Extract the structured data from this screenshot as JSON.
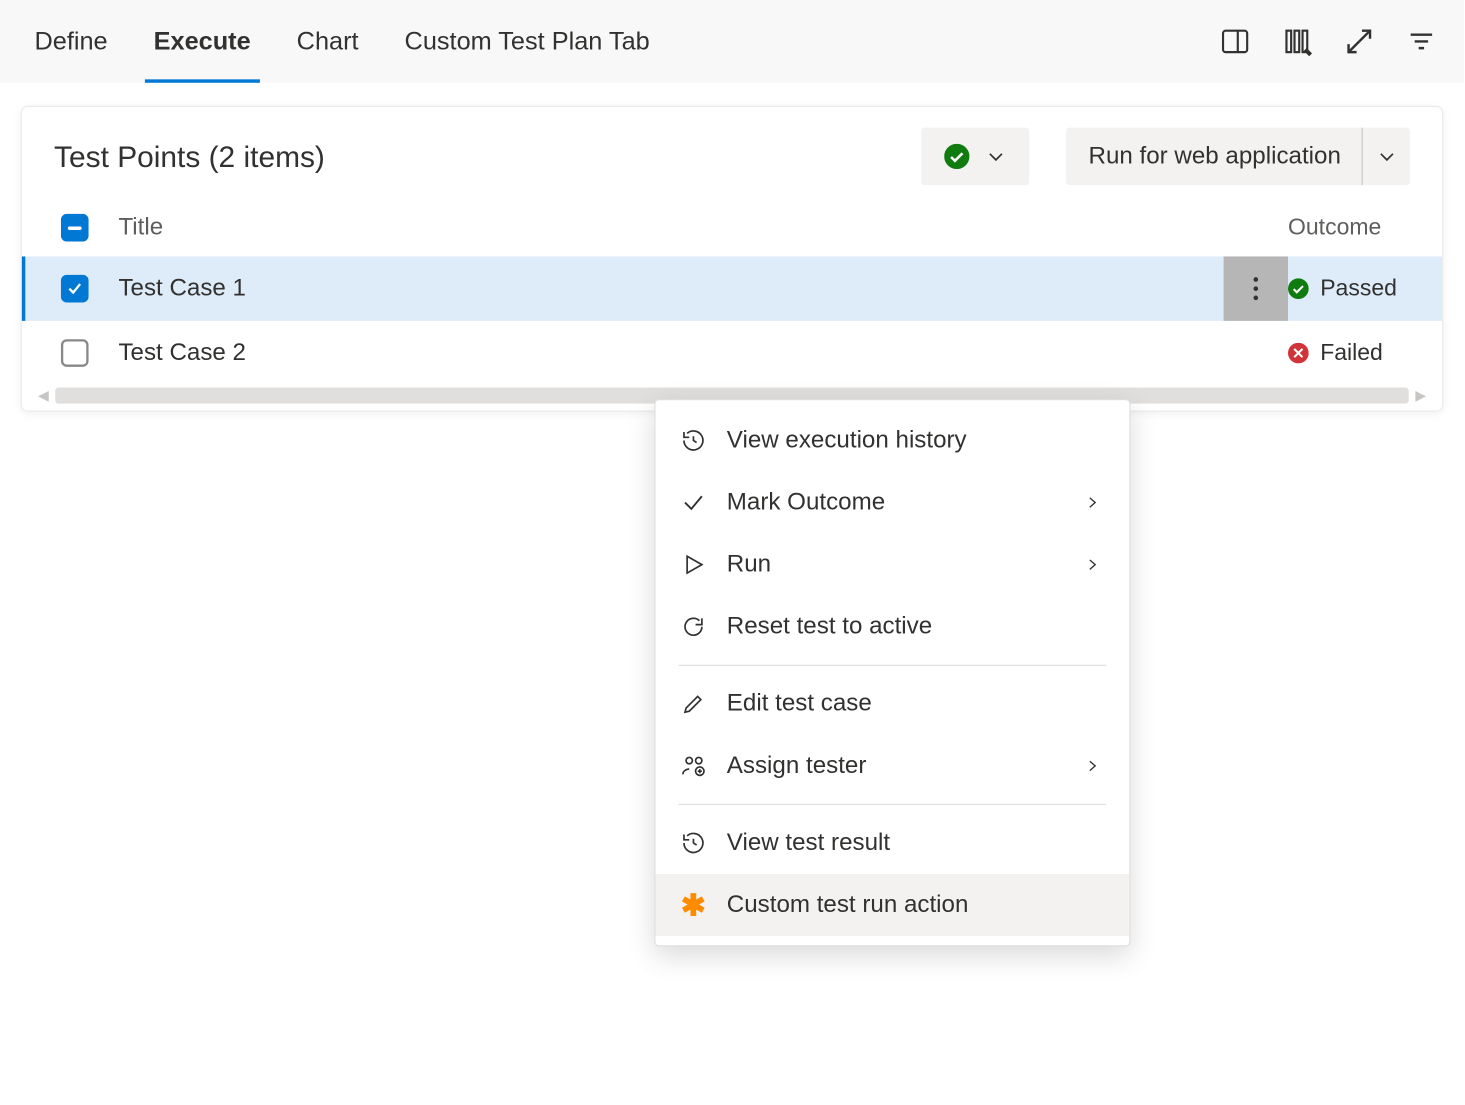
{
  "tabs": {
    "define": "Define",
    "execute": "Execute",
    "chart": "Chart",
    "custom": "Custom Test Plan Tab"
  },
  "panel": {
    "title": "Test Points (2 items)",
    "run_button": "Run for web application"
  },
  "columns": {
    "title": "Title",
    "outcome": "Outcome"
  },
  "rows": [
    {
      "title": "Test Case 1",
      "outcome": "Passed",
      "checked": true,
      "selected": true
    },
    {
      "title": "Test Case 2",
      "outcome": "Failed",
      "checked": false,
      "selected": false
    }
  ],
  "menu": {
    "view_history": "View execution history",
    "mark_outcome": "Mark Outcome",
    "run": "Run",
    "reset": "Reset test to active",
    "edit": "Edit test case",
    "assign": "Assign tester",
    "view_result": "View test result",
    "custom_action": "Custom test run action"
  }
}
